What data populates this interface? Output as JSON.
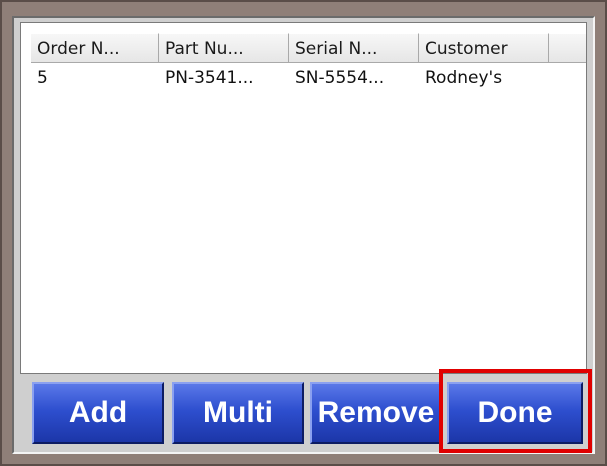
{
  "table": {
    "columns": [
      "Order N...",
      "Part Nu...",
      "Serial N...",
      "Customer"
    ],
    "rows": [
      [
        "5",
        "PN-3541...",
        "SN-5554...",
        "Rodney's"
      ]
    ]
  },
  "buttons": {
    "add": "Add",
    "multi": "Multi",
    "remove": "Remove",
    "done": "Done"
  },
  "colors": {
    "button_blue": "#2e4fcf",
    "highlight_red": "#e00000"
  }
}
